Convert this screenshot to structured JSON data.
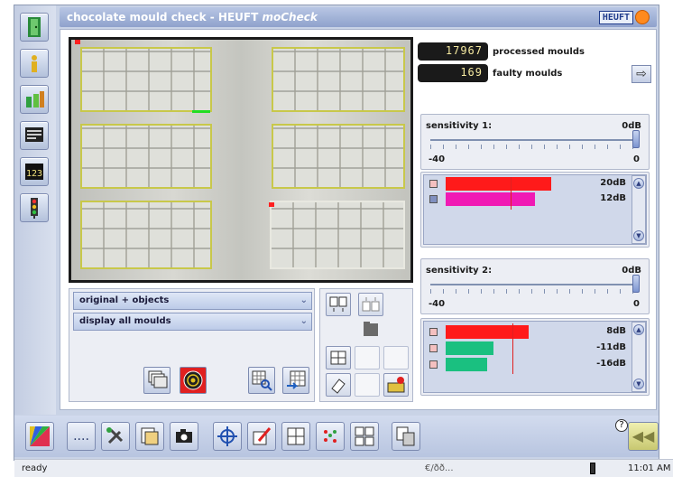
{
  "window": {
    "title": "chocolate mould check - HEUFT ",
    "title_italic": "moCheck",
    "logo_text": "HEUFT"
  },
  "sidebar": {
    "items": [
      {
        "icon": "exit-door-icon"
      },
      {
        "icon": "info-icon"
      },
      {
        "icon": "bottles-icon"
      },
      {
        "icon": "monitor-icon"
      },
      {
        "icon": "counter-icon",
        "label": "123"
      },
      {
        "icon": "traffic-light-icon"
      }
    ]
  },
  "counters": {
    "processed_value": "17967",
    "processed_label": "processed moulds",
    "faulty_value": "169",
    "faulty_label": "faulty moulds"
  },
  "image_view": {
    "mode_select": "original + objects",
    "filter_select": "display all moulds"
  },
  "sensitivity1": {
    "title": "sensitivity 1:",
    "value": "0dB",
    "min_label": "-40",
    "max_label": "0",
    "slider_fraction": 1.0,
    "bars": [
      {
        "color": "#ff1a1a",
        "value": "20dB",
        "fill": 0.53
      },
      {
        "color": "#f01ab4",
        "value": "12dB",
        "fill": 0.45
      }
    ]
  },
  "sensitivity2": {
    "title": "sensitivity 2:",
    "value": "0dB",
    "min_label": "-40",
    "max_label": "0",
    "slider_fraction": 1.0,
    "bars": [
      {
        "color": "#ff1a1a",
        "value": "8dB",
        "fill": 0.42
      },
      {
        "color": "#1ac080",
        "value": "-11dB",
        "fill": 0.24
      },
      {
        "color": "#1ac080",
        "value": "-16dB",
        "fill": 0.21
      }
    ]
  },
  "toolbar": {
    "items": [
      "palette-icon",
      "more-icon",
      "tools-icon",
      "image-settings-icon",
      "camera-icon",
      "crosshair-icon",
      "edit-icon",
      "grid-icon",
      "dots-icon",
      "mould-layout-icon",
      "copy-icon"
    ],
    "more_label": "....",
    "help_label": "?",
    "back_label": "◀◀"
  },
  "statusbar": {
    "state": "ready",
    "network": "€/ðð...",
    "time": "11:01 AM"
  }
}
